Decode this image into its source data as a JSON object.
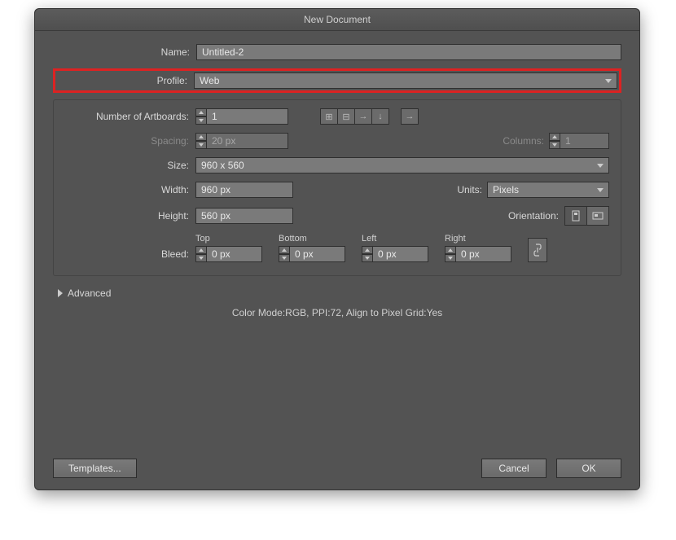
{
  "dialog": {
    "title": "New Document"
  },
  "fields": {
    "name_label": "Name:",
    "name_value": "Untitled-2",
    "profile_label": "Profile:",
    "profile_value": "Web",
    "artboards_label": "Number of Artboards:",
    "artboards_value": "1",
    "spacing_label": "Spacing:",
    "spacing_value": "20 px",
    "columns_label": "Columns:",
    "columns_value": "1",
    "size_label": "Size:",
    "size_value": "960 x 560",
    "width_label": "Width:",
    "width_value": "960 px",
    "units_label": "Units:",
    "units_value": "Pixels",
    "height_label": "Height:",
    "height_value": "560 px",
    "orientation_label": "Orientation:"
  },
  "bleed": {
    "label": "Bleed:",
    "top_label": "Top",
    "top_value": "0 px",
    "bottom_label": "Bottom",
    "bottom_value": "0 px",
    "left_label": "Left",
    "left_value": "0 px",
    "right_label": "Right",
    "right_value": "0 px"
  },
  "advanced_label": "Advanced",
  "summary": "Color Mode:RGB, PPI:72, Align to Pixel Grid:Yes",
  "buttons": {
    "templates": "Templates...",
    "cancel": "Cancel",
    "ok": "OK"
  }
}
